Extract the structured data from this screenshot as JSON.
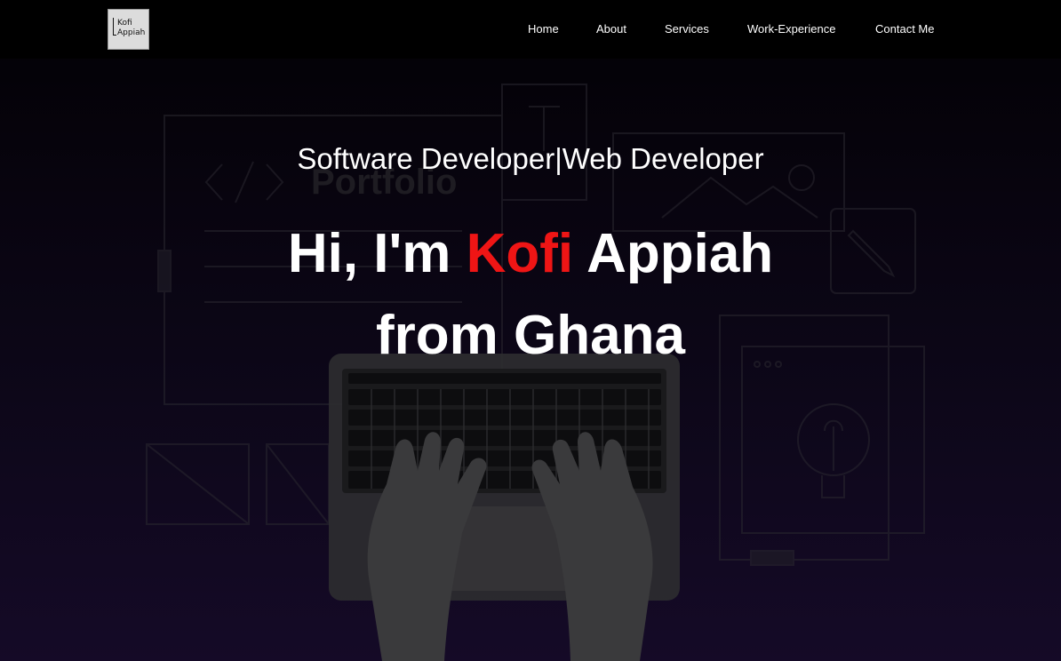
{
  "logo": {
    "line1": "Kofi",
    "line2": "Appiah"
  },
  "nav": {
    "home": "Home",
    "about": "About",
    "services": "Services",
    "work_experience": "Work-Experience",
    "contact": "Contact Me"
  },
  "hero": {
    "subtitle": "Software Developer|Web Developer",
    "greeting": "Hi, I'm",
    "first_name": "Kofi",
    "last_name": "Appiah",
    "origin": "from Ghana",
    "accent_color": "#ef1515"
  }
}
